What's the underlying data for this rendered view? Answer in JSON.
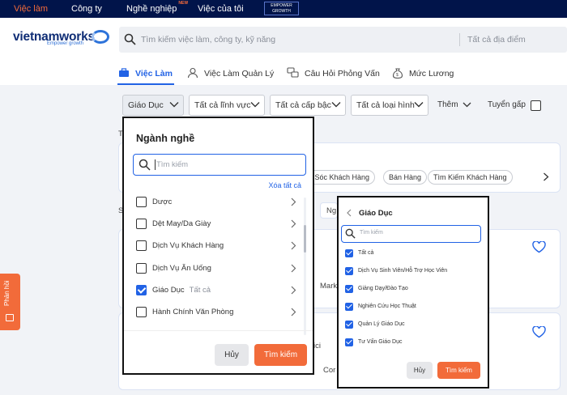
{
  "topnav": {
    "items": [
      "Việc làm",
      "Công ty",
      "Nghề nghiệp",
      "Việc của tôi"
    ],
    "new_badge": "NEW",
    "promo": "EMPOWER GROWTH"
  },
  "logo": {
    "name": "vietnamworks",
    "tagline": "Empower growth"
  },
  "search": {
    "placeholder": "Tìm kiếm việc làm, công ty, kỹ năng",
    "location": "Tất cả địa điểm"
  },
  "tabs": [
    "Việc Làm",
    "Việc Làm Quản Lý",
    "Câu Hỏi Phỏng Vấn",
    "Mức Lương"
  ],
  "filters": {
    "items": [
      "Giáo Dục",
      "Tất cả lĩnh vực",
      "Tất cả cấp bậc",
      "Tất cả loại hình"
    ],
    "more": "Thêm",
    "urgent": "Tuyển gấp"
  },
  "background": {
    "chips": [
      "n Sóc Khách Hàng",
      "Bán Hàng",
      "Tìm Kiếm Khách Hàng"
    ],
    "fragments": [
      "T",
      "S",
      "Ng",
      "Mark",
      "ici",
      "Cor"
    ]
  },
  "feedback": "Phản hồi",
  "panel1": {
    "title": "Ngành nghề",
    "search_placeholder": "Tìm kiếm",
    "clear_all": "Xóa tất cả",
    "rows": [
      {
        "label": "Dược",
        "checked": false,
        "sub": ""
      },
      {
        "label": "Dệt May/Da Giày",
        "checked": false,
        "sub": ""
      },
      {
        "label": "Dịch Vụ Khách Hàng",
        "checked": false,
        "sub": ""
      },
      {
        "label": "Dịch Vụ Ăn Uống",
        "checked": false,
        "sub": ""
      },
      {
        "label": "Giáo Dục",
        "checked": true,
        "sub": "Tất cả"
      },
      {
        "label": "Hành Chính Văn Phòng",
        "checked": false,
        "sub": ""
      }
    ],
    "cancel": "Hủy",
    "submit": "Tìm kiếm"
  },
  "panel2": {
    "title": "Giáo Dục",
    "search_placeholder": "Tìm kiếm",
    "rows": [
      {
        "label": "Tất cả",
        "checked": true
      },
      {
        "label": "Dịch Vụ Sinh Viên/Hỗ Trợ Học Viên",
        "checked": true
      },
      {
        "label": "Giảng Dạy/Đào Tạo",
        "checked": true
      },
      {
        "label": "Nghiên Cứu Học Thuật",
        "checked": true
      },
      {
        "label": "Quản Lý Giáo Dục",
        "checked": true
      },
      {
        "label": "Tư Vấn Giáo Dục",
        "checked": true
      }
    ],
    "cancel": "Hủy",
    "submit": "Tìm kiếm"
  },
  "colors": {
    "navy": "#01144a",
    "accent": "#f26b3a",
    "primary": "#2162e5"
  }
}
